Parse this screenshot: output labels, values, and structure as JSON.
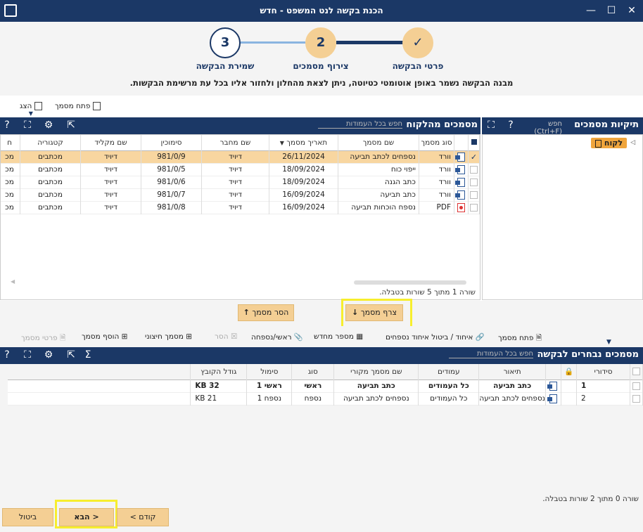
{
  "window": {
    "title": "הכנת בקשה לנט המשפט - חדש",
    "min": "—",
    "max": "☐",
    "close": "✕"
  },
  "steps": [
    {
      "num": "✓",
      "label": "פרטי הבקשה"
    },
    {
      "num": "2",
      "label": "צירוף מסמכים"
    },
    {
      "num": "3",
      "label": "שמירת הבקשה"
    }
  ],
  "draft_note": "מבנה הבקשה נשמר באופן אוטומטי כטיוטה, ניתן לצאת מהחלון ולחזור אליו בכל עת מרשימת הבקשות.",
  "top_toolbar": {
    "open_doc": "פתח מסמך",
    "show": "הצג"
  },
  "folders": {
    "title": "תיקיות מסמכים",
    "search": "חפש (Ctrl+F)",
    "tree_item": "לקוח"
  },
  "client_docs": {
    "title": "מסמכים מהלקוח",
    "search": "חפש בכל העמודות",
    "columns": [
      "סוג מסמך",
      "שם מסמך",
      "תאריך מסמך",
      "שם מחבר",
      "סימוכין",
      "שם מקליד",
      "קטגוריה",
      "ח"
    ],
    "rows": [
      {
        "type": "וורד",
        "name": "נספחים לכתב תביעה",
        "date": "26/11/2024",
        "author": "דיויד",
        "ref": "981/0/9",
        "typist": "דיויד",
        "cat": "מכתבים",
        "h": "מכ"
      },
      {
        "type": "וורד",
        "name": "ייפוי כוח",
        "date": "18/09/2024",
        "author": "דיויד",
        "ref": "981/0/5",
        "typist": "דיויד",
        "cat": "מכתבים",
        "h": "מכ"
      },
      {
        "type": "וורד",
        "name": "כתב הגנה",
        "date": "18/09/2024",
        "author": "דיויד",
        "ref": "981/0/6",
        "typist": "דיויד",
        "cat": "מכתבים",
        "h": "מכ"
      },
      {
        "type": "וורד",
        "name": "כתב תביעה",
        "date": "16/09/2024",
        "author": "דיויד",
        "ref": "981/0/7",
        "typist": "דיויד",
        "cat": "מכתבים",
        "h": "מכ"
      },
      {
        "type": "PDF",
        "name": "נספח הוכחות תביעה",
        "date": "16/09/2024",
        "author": "דיויד",
        "ref": "981/0/8",
        "typist": "דיויד",
        "cat": "מכתבים",
        "h": "מכ"
      }
    ],
    "status": "שורה 1 מתוך 5 שורות בטבלה."
  },
  "middle": {
    "attach": "צרף מסמך",
    "remove": "הסר מסמך"
  },
  "bottom_toolbar": {
    "open_doc": "פתח מסמך",
    "merge": "איחוד / ביטול איחוד נספחים",
    "scan": "מספר מחדש",
    "main_attach": "ראשי/נספחה",
    "remove": "הסר",
    "external": "מסמך חיצוני",
    "add": "הוסף מסמך",
    "details": "פרטי מסמך"
  },
  "selected_docs": {
    "title": "מסמכים נבחרים לבקשה",
    "search": "חפש בכל העמודות",
    "columns": [
      "סידורי",
      "תיאור",
      "עמודים",
      "שם מסמך מקורי",
      "סוג",
      "סימול",
      "גודל הקובץ"
    ],
    "rows": [
      {
        "n": "1",
        "desc": "כתב תביעה",
        "pages": "כל העמודים",
        "orig": "כתב תביעה",
        "kind": "ראשי",
        "mark": "ראשי 1",
        "size": "32 KB"
      },
      {
        "n": "2",
        "desc": "נספחים לכתב תביעה",
        "pages": "כל העמודים",
        "orig": "נספחים לכתב תביעה",
        "kind": "נספח",
        "mark": "נספח 1",
        "size": "21 KB"
      }
    ],
    "status": "שורה 0 מתוך 2 שורות בטבלה."
  },
  "footer": {
    "prev": "< קודם",
    "next": "הבא >",
    "cancel": "ביטול"
  }
}
